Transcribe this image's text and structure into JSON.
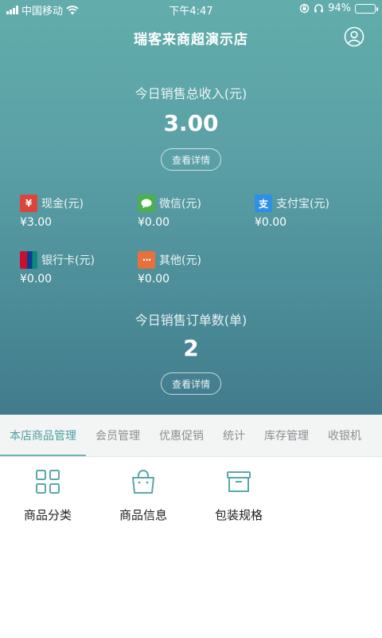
{
  "status_bar": {
    "carrier": "中国移动",
    "time": "下午4:47",
    "battery": "94%",
    "battery_level": 0.94
  },
  "header": {
    "title": "瑞客来商超演示店",
    "user_icon": "user-circle-icon"
  },
  "income": {
    "label": "今日销售总收入(元)",
    "value": "3.00",
    "detail_label": "查看详情"
  },
  "payments": [
    {
      "name": "现金(元)",
      "amount": "¥3.00",
      "icon": "yen-icon",
      "icon_glyph": "¥",
      "color": "#d8463c"
    },
    {
      "name": "微信(元)",
      "amount": "¥0.00",
      "icon": "wechat-icon",
      "color": "#4caf50"
    },
    {
      "name": "支付宝(元)",
      "amount": "¥0.00",
      "icon": "alipay-icon",
      "icon_glyph": "支",
      "color": "#2f8ee6"
    },
    {
      "name": "银行卡(元)",
      "amount": "¥0.00",
      "icon": "unionpay-icon",
      "color": "#c8102e"
    },
    {
      "name": "其他(元)",
      "amount": "¥0.00",
      "icon": "more-dots-icon",
      "icon_glyph": "···",
      "color": "#e8703a"
    }
  ],
  "orders": {
    "label": "今日销售订单数(单)",
    "value": "2",
    "detail_label": "查看详情"
  },
  "tabs": [
    "本店商品管理",
    "会员管理",
    "优惠促销",
    "统计",
    "库存管理",
    "收银机"
  ],
  "active_tab": 0,
  "grid": [
    {
      "label": "商品分类",
      "icon": "category-grid-icon"
    },
    {
      "label": "商品信息",
      "icon": "shopping-bag-icon"
    },
    {
      "label": "包装规格",
      "icon": "package-box-icon"
    }
  ],
  "accent_color": "#5aa8aa"
}
